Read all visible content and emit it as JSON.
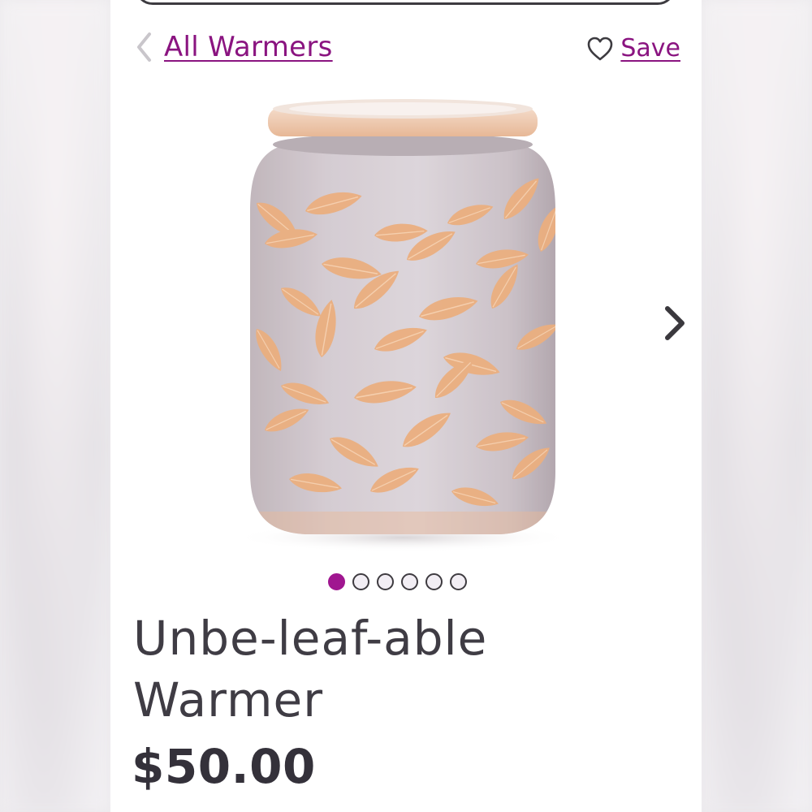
{
  "nav": {
    "back_label": "All Warmers",
    "save_label": "Save"
  },
  "product": {
    "title_line_1": "Unbe-leaf-able",
    "title_line_2": "Warmer",
    "price": "$50.00",
    "image_icon": "leaf-warmer-product-image"
  },
  "carousel": {
    "total_images": 6,
    "active_index": 0
  },
  "colors": {
    "accent": "#8a1480",
    "active_dot": "#a01690",
    "text": "#3f3c44"
  }
}
